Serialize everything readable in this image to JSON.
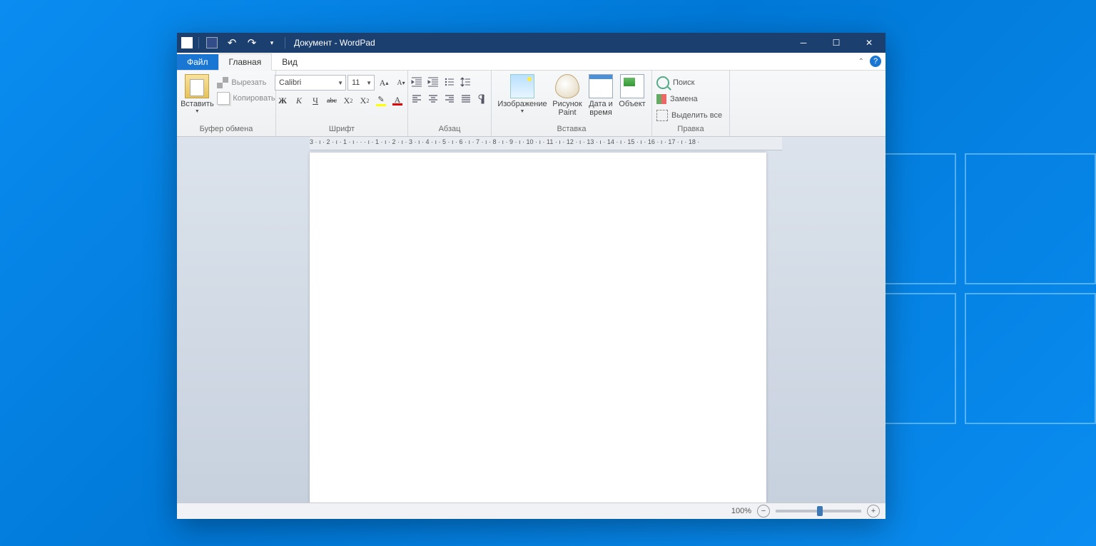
{
  "title": "Документ - WordPad",
  "tabs": {
    "file": "Файл",
    "home": "Главная",
    "view": "Вид"
  },
  "clipboard": {
    "paste": "Вставить",
    "cut": "Вырезать",
    "copy": "Копировать",
    "group": "Буфер обмена"
  },
  "font": {
    "name": "Calibri",
    "size": "11",
    "group": "Шрифт",
    "bold": "Ж",
    "italic": "К",
    "underline": "Ч",
    "strike": "abc",
    "sub": "X",
    "sup": "X",
    "grow": "A",
    "shrink": "A"
  },
  "paragraph": {
    "group": "Абзац"
  },
  "insert": {
    "image": "Изображение",
    "paint": "Рисунок Paint",
    "datetime": "Дата и время",
    "object": "Объект",
    "group": "Вставка"
  },
  "editing": {
    "find": "Поиск",
    "replace": "Замена",
    "selectall": "Выделить все",
    "group": "Правка"
  },
  "ruler": "3 · ı · 2 · ı · 1 · ı · · · ı · 1 · ı · 2 · ı · 3 · ı · 4 · ı · 5 · ı · 6 · ı · 7 · ı · 8 · ı · 9 · ı · 10 · ı · 11 · ı · 12 · ı · 13 · ı · 14 · ı · 15 · ı · 16 · ı · 17 · ı · 18 ·",
  "status": {
    "zoom": "100%"
  }
}
